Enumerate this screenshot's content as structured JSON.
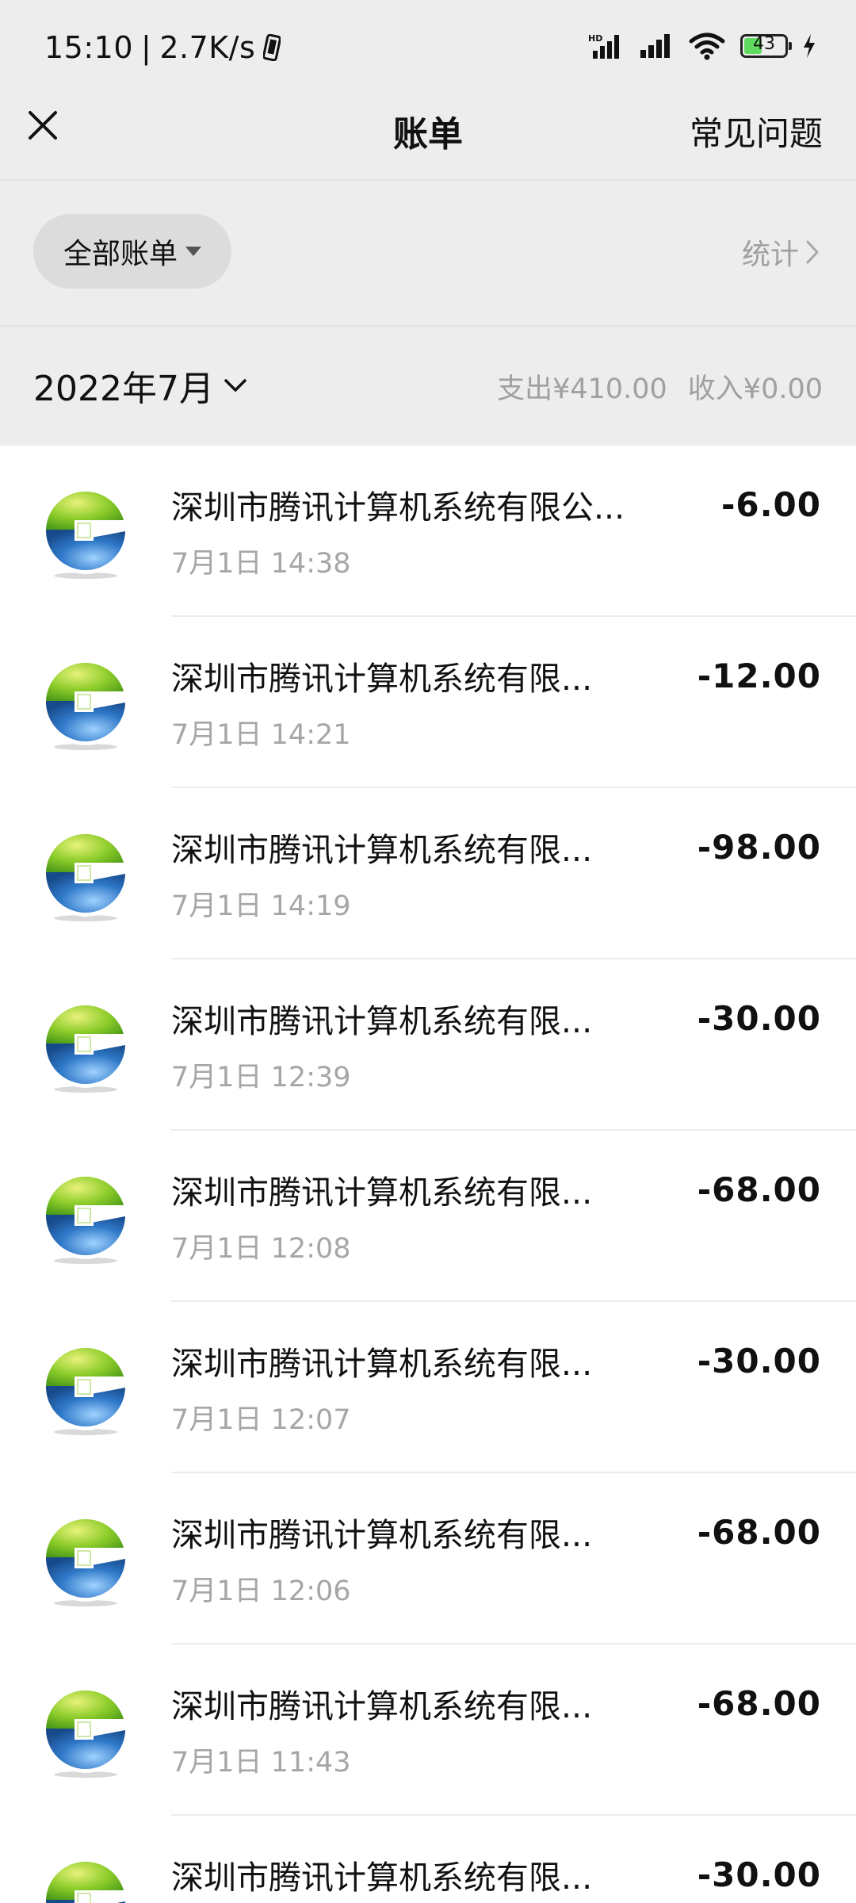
{
  "status_bar": {
    "time": "15:10",
    "separator": "|",
    "network_speed": "2.7K/s",
    "battery_level": "43",
    "battery_fraction": 0.43,
    "icons": [
      "phone-vibrate-icon",
      "hd-signal-icon",
      "cell-signal-icon",
      "wifi-icon",
      "battery-icon",
      "charging-icon"
    ]
  },
  "header": {
    "title": "账单",
    "faq_label": "常见问题",
    "close_icon": "close-icon"
  },
  "filter": {
    "label": "全部账单",
    "stats_label": "统计"
  },
  "month": {
    "label": "2022年7月",
    "expense_label": "支出¥410.00",
    "income_label": "收入¥0.00"
  },
  "colors": {
    "header_bg": "#ededed",
    "pill_bg": "#dcdcdc",
    "muted_text": "#a0a0a0",
    "logo_green": "#8ccc2a",
    "logo_blue": "#2f78c8",
    "battery_green": "#5fdc5f"
  },
  "transactions": [
    {
      "name": "深圳市腾讯计算机系统有限公...",
      "time": "7月1日 14:38",
      "amount": "-6.00"
    },
    {
      "name": "深圳市腾讯计算机系统有限...",
      "time": "7月1日 14:21",
      "amount": "-12.00"
    },
    {
      "name": "深圳市腾讯计算机系统有限...",
      "time": "7月1日 14:19",
      "amount": "-98.00"
    },
    {
      "name": "深圳市腾讯计算机系统有限...",
      "time": "7月1日 12:39",
      "amount": "-30.00"
    },
    {
      "name": "深圳市腾讯计算机系统有限...",
      "time": "7月1日 12:08",
      "amount": "-68.00"
    },
    {
      "name": "深圳市腾讯计算机系统有限...",
      "time": "7月1日 12:07",
      "amount": "-30.00"
    },
    {
      "name": "深圳市腾讯计算机系统有限...",
      "time": "7月1日 12:06",
      "amount": "-68.00"
    },
    {
      "name": "深圳市腾讯计算机系统有限...",
      "time": "7月1日 11:43",
      "amount": "-68.00"
    },
    {
      "name": "深圳市腾讯计算机系统有限...",
      "time": "",
      "amount": "-30.00"
    }
  ]
}
